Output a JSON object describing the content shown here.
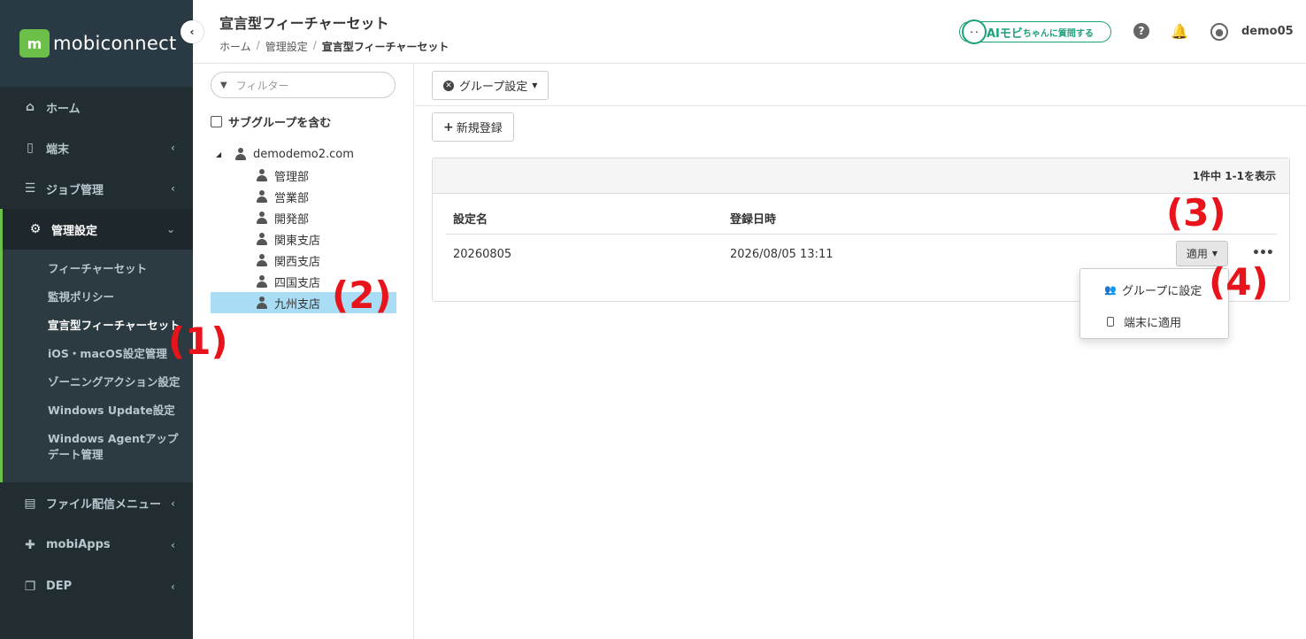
{
  "app": {
    "logo_m": "m",
    "logo_text": "mobiconnect"
  },
  "sidebar": {
    "collapse_icon": "chevron-left-icon",
    "items_top": [
      {
        "label": "ホーム",
        "icon": "home-icon",
        "glyph": "⌂",
        "arrow": ""
      },
      {
        "label": "端末",
        "icon": "device-icon",
        "glyph": "▯",
        "arrow": "‹"
      },
      {
        "label": "ジョブ管理",
        "icon": "job-icon",
        "glyph": "☰",
        "arrow": "‹"
      }
    ],
    "active_item": {
      "label": "管理設定",
      "icon": "gears-icon",
      "glyph": "⚙",
      "arrow": "⌄"
    },
    "submenu": [
      "フィーチャーセット",
      "監視ポリシー",
      "宣言型フィーチャーセット",
      "iOS・macOS設定管理",
      "ゾーニングアクション設定",
      "Windows Update設定",
      "Windows Agentアップデート管理"
    ],
    "items_bottom": [
      {
        "label": "ファイル配信メニュー",
        "icon": "file-icon",
        "glyph": "▤",
        "arrow": "‹"
      },
      {
        "label": "mobiApps",
        "icon": "puzzle-icon",
        "glyph": "✚",
        "arrow": "‹"
      },
      {
        "label": "DEP",
        "icon": "copy-icon",
        "glyph": "❐",
        "arrow": "‹"
      }
    ]
  },
  "header": {
    "title": "宣言型フィーチャーセット",
    "breadcrumb": [
      "ホーム",
      "管理設定",
      "宣言型フィーチャーセット"
    ],
    "breadcrumb_sep": "/",
    "ai_button": {
      "main": "AIモビ",
      "small": "ちゃん",
      "rest": "に質問する",
      "face": "· ·"
    },
    "help_glyph": "?",
    "bell_glyph": "🔔",
    "user_glyph": "●",
    "username": "demo05"
  },
  "tree": {
    "filter_placeholder": "フィルター",
    "filter_glyph": "▼",
    "include_subgroups": "サブグループを含む",
    "root": {
      "label": "demodemo2.com",
      "toggle": "◢"
    },
    "children": [
      "管理部",
      "営業部",
      "開発部",
      "関東支店",
      "関西支店",
      "四国支店",
      "九州支店"
    ],
    "selected": "九州支店"
  },
  "main": {
    "group_settings_label": "グループ設定",
    "new_button_label": "新規登録",
    "count_text": "1件中 1-1を表示",
    "columns": [
      "設定名",
      "登録日時"
    ],
    "rows": [
      {
        "name": "20260805",
        "date": "2026/08/05 13:11"
      }
    ],
    "apply_label": "適用",
    "more_label": "•••",
    "dropdown": [
      {
        "label": "グループに設定",
        "icon": "users-icon",
        "glyph": "👥"
      },
      {
        "label": "端末に適用",
        "icon": "device-icon"
      }
    ]
  },
  "annotations": [
    "(1)",
    "(2)",
    "(3)",
    "(4)"
  ],
  "colors": {
    "sidebar_bg": "#222d32",
    "accent_green": "#6cc04a",
    "ai_green": "#1aa37a",
    "selected_row": "#a8ddf5",
    "annotation_red": "#e8141b"
  }
}
